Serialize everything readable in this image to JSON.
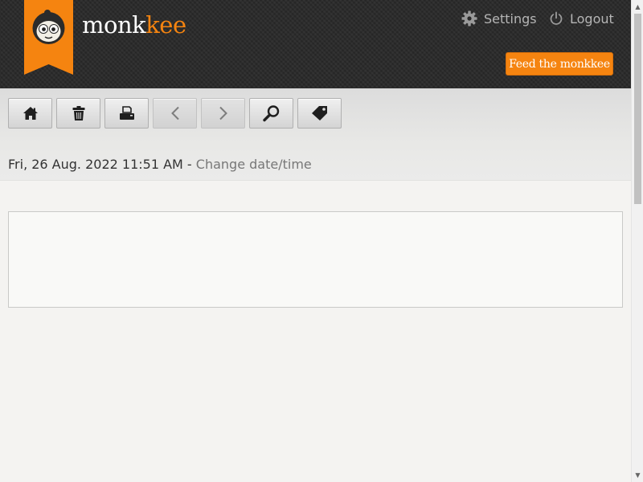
{
  "header": {
    "logo_text_main": "monk",
    "logo_text_accent": "kee",
    "nav": {
      "settings": {
        "label": "Settings",
        "icon": "gear-icon"
      },
      "logout": {
        "label": "Logout",
        "icon": "power-icon"
      }
    },
    "feed_button": "Feed the monkkee"
  },
  "toolbar": {
    "buttons": [
      {
        "icon": "home-icon",
        "enabled": true
      },
      {
        "icon": "trash-icon",
        "enabled": true
      },
      {
        "icon": "printer-icon",
        "enabled": true
      },
      {
        "icon": "chevron-left-icon",
        "enabled": false
      },
      {
        "icon": "chevron-right-icon",
        "enabled": false
      },
      {
        "icon": "search-icon",
        "enabled": true
      },
      {
        "icon": "tag-icon",
        "enabled": true
      }
    ]
  },
  "entry": {
    "date": "Fri, 26 Aug. 2022 11:51 AM",
    "separator": " - ",
    "change_link": "Change date/time",
    "content": ""
  },
  "colors": {
    "brand_orange": "#f58410",
    "header_dark": "#2a2a2a",
    "page_background": "#f4f3f1"
  }
}
